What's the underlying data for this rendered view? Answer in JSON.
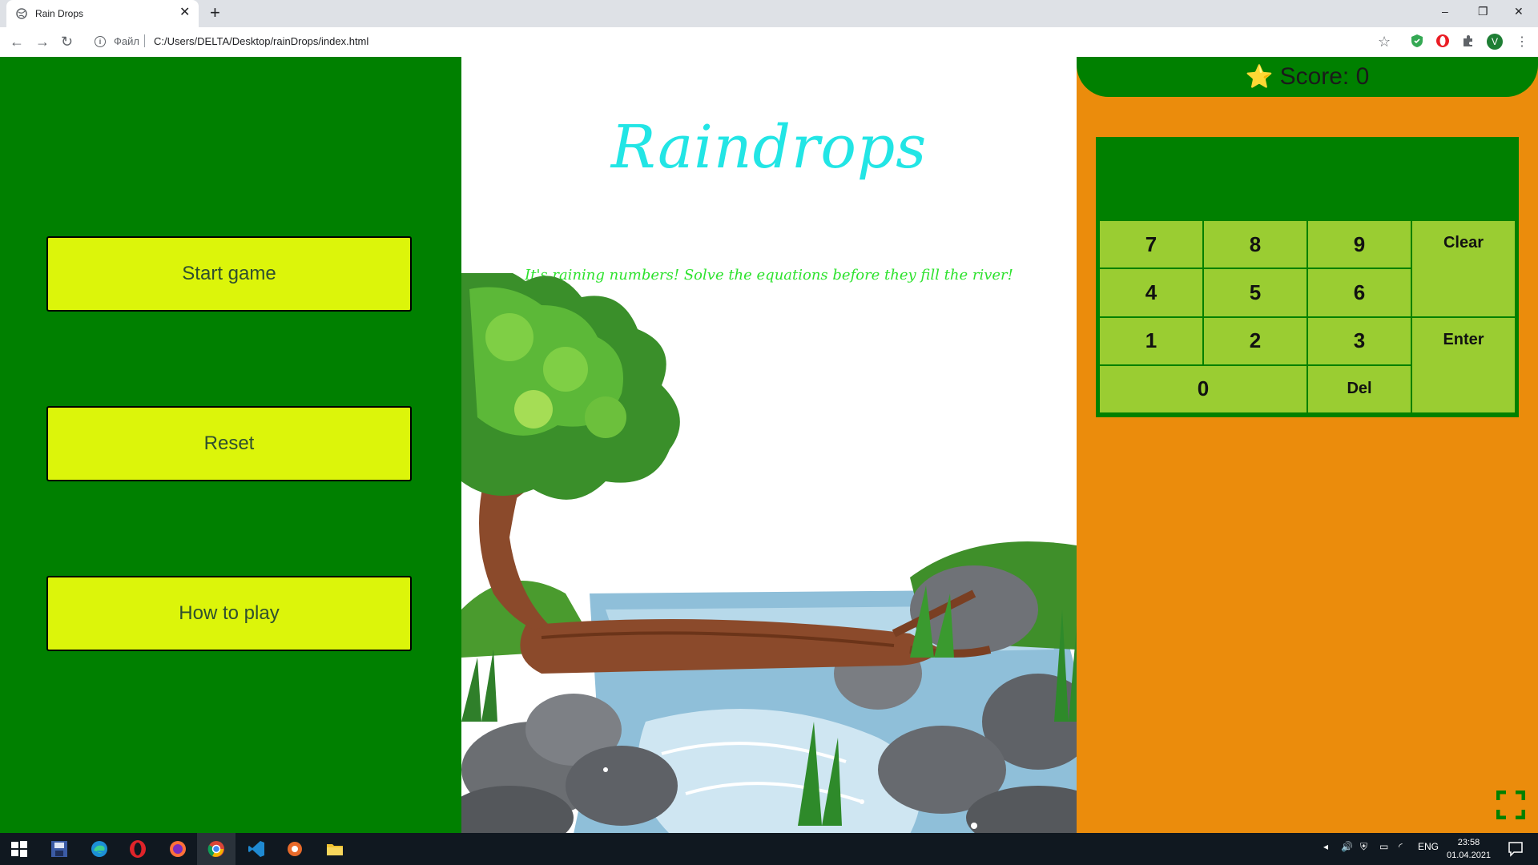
{
  "browser": {
    "tab_title": "Rain Drops",
    "tab_close": "✕",
    "new_tab": "+",
    "scheme_label": "Файл",
    "separator": "|",
    "url": "C:/Users/DELTA/Desktop/rainDrops/index.html",
    "window_controls": [
      "–",
      "❐",
      "✕"
    ],
    "profile_initial": "V"
  },
  "left_menu": {
    "buttons": [
      "Start game",
      "Reset",
      "How to play"
    ]
  },
  "center": {
    "title": "Raindrops",
    "subtitle": "It's raining numbers! Solve the equations before they fill the river!"
  },
  "scoreboard": {
    "star": "⭐",
    "score_text": "Score: 0"
  },
  "keypad": {
    "keys": [
      "7",
      "8",
      "9",
      "Clear",
      "4",
      "5",
      "6",
      "1",
      "2",
      "3",
      "Enter",
      "0",
      "Del"
    ]
  },
  "taskbar": {
    "language": "ENG",
    "time": "23:58",
    "date": "01.04.2021"
  },
  "colors": {
    "left_panel": "#008000",
    "menu_button": "#dcf50a",
    "right_panel": "#eb8c0c",
    "key": "#9acd32",
    "title": "#22e5e5",
    "subtitle": "#2ee22e"
  }
}
